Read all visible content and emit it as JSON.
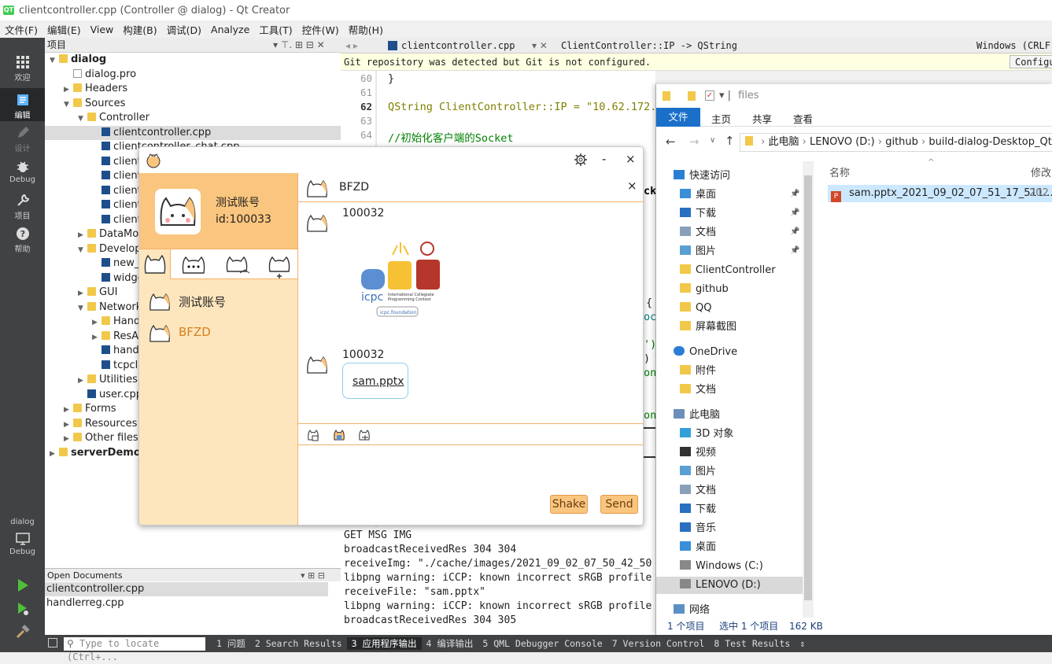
{
  "window": {
    "title": "clientcontroller.cpp (Controller @ dialog) - Qt Creator",
    "logo": "QT"
  },
  "menu": [
    "文件(F)",
    "编辑(E)",
    "View",
    "构建(B)",
    "调试(D)",
    "Analyze",
    "工具(T)",
    "控件(W)",
    "帮助(H)"
  ],
  "modes": {
    "welcome": "欢迎",
    "edit": "编辑",
    "design": "设计",
    "debug": "Debug",
    "projects": "项目",
    "help": "帮助",
    "kit_project": "dialog",
    "kit_config": "Debug"
  },
  "project_panel": {
    "title": "项目",
    "tree": [
      {
        "label": "dialog",
        "level": 0,
        "kind": "project",
        "open": true
      },
      {
        "label": "dialog.pro",
        "level": 1,
        "kind": "pro"
      },
      {
        "label": "Headers",
        "level": 1,
        "kind": "folder",
        "open": false
      },
      {
        "label": "Sources",
        "level": 1,
        "kind": "folder",
        "open": true
      },
      {
        "label": "Controller",
        "level": 2,
        "kind": "folder",
        "open": true
      },
      {
        "label": "clientcontroller.cpp",
        "level": 3,
        "kind": "cpp",
        "selected": true
      },
      {
        "label": "clientcontroller_chat.cpp",
        "level": 3,
        "kind": "cpp"
      },
      {
        "label": "clientcontroller_file.cpp",
        "level": 3,
        "kind": "cpp"
      },
      {
        "label": "clientcontroller_img.cpp",
        "level": 3,
        "kind": "cpp"
      },
      {
        "label": "clientcontroller_login.cpp",
        "level": 3,
        "kind": "cpp"
      },
      {
        "label": "clientcontroller_msg.cpp",
        "level": 3,
        "kind": "cpp"
      },
      {
        "label": "clientcontroller_user.cpp",
        "level": 3,
        "kind": "cpp"
      },
      {
        "label": "DataModel",
        "level": 2,
        "kind": "folder",
        "open": false
      },
      {
        "label": "Developer",
        "level": 2,
        "kind": "folder",
        "open": true
      },
      {
        "label": "new_",
        "level": 3,
        "kind": "cpp"
      },
      {
        "label": "widget",
        "level": 3,
        "kind": "cpp"
      },
      {
        "label": "GUI",
        "level": 2,
        "kind": "folder",
        "open": false
      },
      {
        "label": "Network",
        "level": 2,
        "kind": "folder",
        "open": true
      },
      {
        "label": "Handler",
        "level": 3,
        "kind": "folder",
        "open": false
      },
      {
        "label": "ResA",
        "level": 3,
        "kind": "folder",
        "open": false
      },
      {
        "label": "handler",
        "level": 3,
        "kind": "cpp"
      },
      {
        "label": "tcpclient",
        "level": 3,
        "kind": "cpp"
      },
      {
        "label": "Utilities",
        "level": 2,
        "kind": "folder",
        "open": false
      },
      {
        "label": "user.cpp",
        "level": 2,
        "kind": "cpp"
      },
      {
        "label": "Forms",
        "level": 1,
        "kind": "folder",
        "open": false
      },
      {
        "label": "Resources",
        "level": 1,
        "kind": "folder",
        "open": false
      },
      {
        "label": "Other files",
        "level": 1,
        "kind": "folder",
        "open": false
      },
      {
        "label": "serverDemo",
        "level": 0,
        "kind": "project",
        "open": false
      }
    ]
  },
  "open_documents": {
    "title": "Open Documents",
    "items": [
      "clientcontroller.cpp",
      "handlerreg.cpp"
    ]
  },
  "editor": {
    "tab_file": "clientcontroller.cpp",
    "symbol": "ClientController::IP -> QString",
    "line_ending": "Windows (CRLF",
    "git_notice": "Git repository was detected but Git is not configured.",
    "git_button": "Configu",
    "lines": [
      {
        "n": "60",
        "text": "}"
      },
      {
        "n": "61",
        "text": ""
      },
      {
        "n": "62",
        "text": "QString ClientController::IP = \"10.62.172.1"
      },
      {
        "n": "63",
        "text": ""
      },
      {
        "n": "64",
        "text": "//初始化客户端的Socket"
      }
    ],
    "fragments": [
      "cke",
      "{",
      "ocl",
      "')",
      ") +",
      "onn",
      "onn"
    ]
  },
  "output": {
    "lines": [
      "GET MSG IMG",
      "broadcastReceivedRes   304   304",
      "receiveImg: \"./cache/images/2021_09_02_07_50_42_50",
      "libpng warning: iCCP: known incorrect sRGB profile",
      "receiveFile: \"sam.pptx\"",
      "libpng warning: iCCP: known incorrect sRGB profile",
      "broadcastReceivedRes   304   305"
    ]
  },
  "statusbar": {
    "locator_placeholder": "Type to locate (Ctrl+...",
    "panes": [
      "1 问题",
      "2 Search Results",
      "3 应用程序输出",
      "4 编译输出",
      "5 QML Debugger Console",
      "7 Version Control",
      "8 Test Results"
    ],
    "more": "⇕"
  },
  "chat": {
    "profile": {
      "name": "测试账号",
      "id": "id:100033"
    },
    "contacts": [
      "测试账号",
      "BFZD"
    ],
    "conversation_title": "BFZD",
    "messages": [
      {
        "sender": "100032",
        "type": "image",
        "logo_text_1": "icpc",
        "logo_text_2": "International Collegiate",
        "logo_text_3": "Programming Contest",
        "logo_text_4": "icpc.foundation"
      },
      {
        "sender": "100032",
        "type": "file",
        "filename": "sam.pptx"
      }
    ],
    "buttons": {
      "shake": "Shake",
      "send": "Send"
    },
    "controls": {
      "min": "-",
      "close": "×"
    }
  },
  "explorer": {
    "title": "files",
    "ribbon": [
      "文件",
      "主页",
      "共享",
      "查看"
    ],
    "path": [
      "此电脑",
      "LENOVO (D:)",
      "github",
      "build-dialog-Desktop_Qt"
    ],
    "nav": [
      {
        "label": "快速访问",
        "kind": "star",
        "indent": 0
      },
      {
        "label": "桌面",
        "kind": "desktop",
        "indent": 1,
        "pin": true
      },
      {
        "label": "下载",
        "kind": "download",
        "indent": 1,
        "pin": true
      },
      {
        "label": "文档",
        "kind": "doc",
        "indent": 1,
        "pin": true
      },
      {
        "label": "图片",
        "kind": "pic",
        "indent": 1,
        "pin": true
      },
      {
        "label": "ClientController",
        "kind": "folder",
        "indent": 1
      },
      {
        "label": "github",
        "kind": "folder",
        "indent": 1
      },
      {
        "label": "QQ",
        "kind": "folder",
        "indent": 1
      },
      {
        "label": "屏幕截图",
        "kind": "folder",
        "indent": 1
      },
      {
        "label": "OneDrive",
        "kind": "cloud",
        "indent": 0
      },
      {
        "label": "附件",
        "kind": "folder",
        "indent": 1
      },
      {
        "label": "文档",
        "kind": "folder",
        "indent": 1
      },
      {
        "label": "此电脑",
        "kind": "pc",
        "indent": 0
      },
      {
        "label": "3D 对象",
        "kind": "3d",
        "indent": 1
      },
      {
        "label": "视频",
        "kind": "video",
        "indent": 1
      },
      {
        "label": "图片",
        "kind": "pic",
        "indent": 1
      },
      {
        "label": "文档",
        "kind": "doc",
        "indent": 1
      },
      {
        "label": "下载",
        "kind": "download",
        "indent": 1
      },
      {
        "label": "音乐",
        "kind": "music",
        "indent": 1
      },
      {
        "label": "桌面",
        "kind": "desktop",
        "indent": 1
      },
      {
        "label": "Windows (C:)",
        "kind": "drive",
        "indent": 1
      },
      {
        "label": "LENOVO (D:)",
        "kind": "drive",
        "indent": 1,
        "selected": true
      },
      {
        "label": "网络",
        "kind": "net",
        "indent": 0
      }
    ],
    "columns": [
      "名称",
      "修改"
    ],
    "files": [
      {
        "name": "sam.pptx_2021_09_02_07_51_17_511...",
        "date": "202"
      }
    ],
    "status": {
      "count": "1 个项目",
      "selected": "选中 1 个项目",
      "size": "162 KB"
    }
  },
  "colors": {
    "accent": "#fac57e",
    "panel": "#fde6bd",
    "accent_border": "#f3b06a",
    "qt_green": "#41cd52",
    "keyword": "#808000",
    "string": "#008000",
    "comment": "#008000"
  }
}
